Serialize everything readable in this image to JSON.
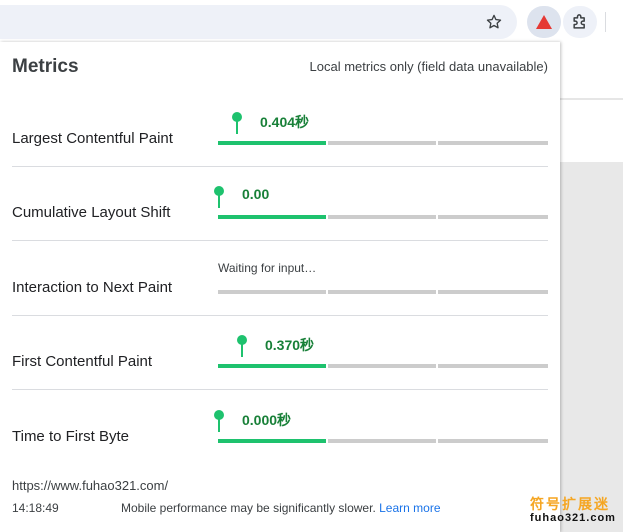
{
  "toolbar": {
    "icons": [
      "star-icon",
      "web-vitals-extension-icon",
      "extensions-puzzle-icon"
    ],
    "accent": "#e53935"
  },
  "popup": {
    "title": "Metrics",
    "subtitle": "Local metrics only (field data unavailable)",
    "metrics": [
      {
        "name": "Largest Contentful Paint",
        "value": "0.404秒",
        "status": "good",
        "level": 0.12
      },
      {
        "name": "Cumulative Layout Shift",
        "value": "0.00",
        "status": "good",
        "level": 0.0
      },
      {
        "name": "Interaction to Next Paint",
        "value": "Waiting for input…",
        "status": "waiting",
        "level": null
      },
      {
        "name": "First Contentful Paint",
        "value": "0.370秒",
        "status": "good",
        "level": 0.14
      },
      {
        "name": "Time to First Byte",
        "value": "0.000秒",
        "status": "good",
        "level": 0.0
      }
    ],
    "footer": {
      "url": "https://www.fuhao321.com/",
      "time": "14:18:49",
      "note": "Mobile performance may be significantly slower.",
      "link": "Learn more"
    }
  },
  "watermark": {
    "line1": "符号扩展迷",
    "line2": "fuhao321.com"
  },
  "colors": {
    "good": "#1ec26e",
    "good_text": "#188038",
    "track": "#cccccc",
    "link": "#1a73e8"
  }
}
